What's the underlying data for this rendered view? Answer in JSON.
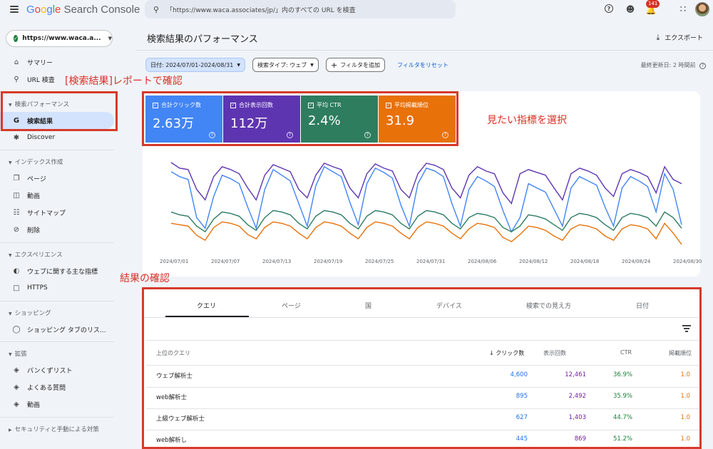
{
  "header": {
    "logo": "Google Search Console",
    "search_placeholder": "「https://www.waca.associates/jp/」内のすべての URL を検査",
    "notification_count": "141"
  },
  "sidebar": {
    "property": "https://www.waca.a...",
    "items_top": [
      {
        "label": "サマリー",
        "icon": "home-icon"
      },
      {
        "label": "URL 検査",
        "icon": "search-icon"
      }
    ],
    "section_performance": "検索パフォーマンス",
    "items_performance": [
      {
        "label": "検索結果",
        "icon": "google-g-icon"
      },
      {
        "label": "Discover",
        "icon": "asterisk-icon"
      }
    ],
    "section_index": "インデックス作成",
    "items_index": [
      {
        "label": "ページ",
        "icon": "pages-icon"
      },
      {
        "label": "動画",
        "icon": "video-icon"
      },
      {
        "label": "サイトマップ",
        "icon": "sitemap-icon"
      },
      {
        "label": "削除",
        "icon": "eye-off-icon"
      }
    ],
    "section_experience": "エクスペリエンス",
    "items_experience": [
      {
        "label": "ウェブに関する主な指標",
        "icon": "gauge-icon"
      },
      {
        "label": "HTTPS",
        "icon": "lock-icon"
      }
    ],
    "section_shopping": "ショッピング",
    "items_shopping": [
      {
        "label": "ショッピング タブのリス...",
        "icon": "tag-icon"
      }
    ],
    "section_extensions": "拡張",
    "items_extensions": [
      {
        "label": "パンくずリスト",
        "icon": "layers-icon"
      },
      {
        "label": "よくある質問",
        "icon": "layers-icon"
      },
      {
        "label": "動画",
        "icon": "layers-icon"
      }
    ],
    "section_security": "セキュリティと手動による対策"
  },
  "main": {
    "title": "検索結果のパフォーマンス",
    "export": "エクスポート",
    "filters": {
      "date": "日付: 2024/07/01-2024/08/31",
      "search_type": "検索タイプ: ウェブ",
      "add_filter": "フィルタを追加",
      "reset": "フィルタをリセット"
    },
    "last_updated": "最終更新日: 2 時間前",
    "metrics": [
      {
        "label": "合計クリック数",
        "value": "2.63万",
        "color": "#4285f4"
      },
      {
        "label": "合計表示回数",
        "value": "112万",
        "color": "#5e35b1"
      },
      {
        "label": "平均 CTR",
        "value": "2.4%",
        "color": "#2e7d5f"
      },
      {
        "label": "平均掲載順位",
        "value": "31.9",
        "color": "#e8710a"
      }
    ],
    "tabs": [
      "クエリ",
      "ページ",
      "国",
      "デバイス",
      "検索での見え方",
      "日付"
    ],
    "table": {
      "headers": {
        "query": "上位のクエリ",
        "clicks": "クリック数",
        "impressions": "表示回数",
        "ctr": "CTR",
        "position": "掲載順位"
      },
      "rows": [
        {
          "query": "ウェブ解析士",
          "clicks": "4,600",
          "impressions": "12,461",
          "ctr": "36.9%",
          "position": "1.0"
        },
        {
          "query": "web解析士",
          "clicks": "895",
          "impressions": "2,492",
          "ctr": "35.9%",
          "position": "1.0"
        },
        {
          "query": "上級ウェブ解析士",
          "clicks": "627",
          "impressions": "1,403",
          "ctr": "44.7%",
          "position": "1.0"
        },
        {
          "query": "web解析し",
          "clicks": "445",
          "impressions": "869",
          "ctr": "51.2%",
          "position": "1.0"
        }
      ]
    }
  },
  "annotations": {
    "report": "[検索結果]レポートで確認",
    "select": "見たい指標を選択",
    "confirm": "結果の確認"
  },
  "chart_data": {
    "type": "line",
    "x_ticks": [
      "2024/07/01",
      "2024/07/07",
      "2024/07/13",
      "2024/07/19",
      "2024/07/25",
      "2024/07/31",
      "2024/08/06",
      "2024/08/12",
      "2024/08/18",
      "2024/08/24",
      "2024/08/30"
    ],
    "grid": false,
    "series": [
      {
        "name": "合計表示回数",
        "color": "#5e35b1",
        "values": [
          0.98,
          0.9,
          0.88,
          0.6,
          0.45,
          0.78,
          0.92,
          0.88,
          0.82,
          0.62,
          0.45,
          0.8,
          0.95,
          0.9,
          0.85,
          0.6,
          0.48,
          0.8,
          0.97,
          0.92,
          0.88,
          0.62,
          0.48,
          0.82,
          0.96,
          0.9,
          0.86,
          0.6,
          0.48,
          0.82,
          0.97,
          0.94,
          0.88,
          0.62,
          0.48,
          0.8,
          0.92,
          0.86,
          0.82,
          0.55,
          0.4,
          0.82,
          0.88,
          0.84,
          0.8,
          0.62,
          0.45,
          0.82,
          0.9,
          0.86,
          0.8,
          0.62,
          0.5,
          0.82,
          0.88,
          0.84,
          0.78,
          0.55,
          0.92,
          0.74,
          0.68
        ]
      },
      {
        "name": "合計クリック数",
        "color": "#4285f4",
        "values": [
          0.85,
          0.78,
          0.74,
          0.2,
          0.05,
          0.5,
          0.8,
          0.75,
          0.68,
          0.35,
          0.05,
          0.6,
          0.88,
          0.8,
          0.72,
          0.4,
          0.08,
          0.65,
          0.92,
          0.85,
          0.78,
          0.42,
          0.1,
          0.68,
          0.9,
          0.84,
          0.76,
          0.38,
          0.08,
          0.68,
          0.9,
          0.86,
          0.78,
          0.4,
          0.08,
          0.6,
          0.78,
          0.72,
          0.64,
          0.3,
          0.0,
          0.2,
          0.68,
          0.62,
          0.56,
          0.32,
          0.08,
          0.62,
          0.78,
          0.72,
          0.66,
          0.35,
          0.08,
          0.62,
          0.78,
          0.72,
          0.64,
          0.28,
          0.82,
          0.6,
          0.1
        ]
      },
      {
        "name": "平均 CTR",
        "color": "#2e7d5f",
        "values": [
          0.28,
          0.24,
          0.22,
          0.08,
          0.0,
          0.18,
          0.28,
          0.26,
          0.22,
          0.1,
          0.02,
          0.2,
          0.3,
          0.28,
          0.24,
          0.12,
          0.04,
          0.22,
          0.3,
          0.28,
          0.24,
          0.12,
          0.04,
          0.22,
          0.3,
          0.28,
          0.24,
          0.12,
          0.04,
          0.22,
          0.3,
          0.28,
          0.24,
          0.12,
          0.04,
          0.2,
          0.26,
          0.24,
          0.2,
          0.06,
          0.0,
          0.08,
          0.24,
          0.22,
          0.18,
          0.1,
          0.02,
          0.2,
          0.26,
          0.24,
          0.2,
          0.1,
          0.02,
          0.2,
          0.26,
          0.24,
          0.2,
          0.08,
          0.28,
          0.2,
          0.05
        ]
      },
      {
        "name": "平均掲載順位",
        "color": "#e8710a",
        "values": [
          0.12,
          0.1,
          0.08,
          -0.05,
          -0.12,
          0.06,
          0.14,
          0.12,
          0.08,
          -0.04,
          -0.1,
          0.06,
          0.14,
          0.12,
          0.08,
          -0.02,
          -0.1,
          0.06,
          0.14,
          0.12,
          0.08,
          -0.02,
          -0.1,
          0.06,
          0.14,
          0.12,
          0.08,
          -0.02,
          -0.1,
          0.06,
          0.14,
          0.12,
          0.08,
          -0.02,
          -0.1,
          0.04,
          0.12,
          0.1,
          0.06,
          -0.08,
          -0.14,
          -0.04,
          0.08,
          0.06,
          0.02,
          -0.06,
          -0.12,
          0.04,
          0.1,
          0.08,
          0.04,
          -0.06,
          -0.12,
          0.04,
          0.1,
          0.08,
          0.04,
          -0.1,
          0.12,
          -0.02,
          -0.18
        ]
      }
    ]
  }
}
